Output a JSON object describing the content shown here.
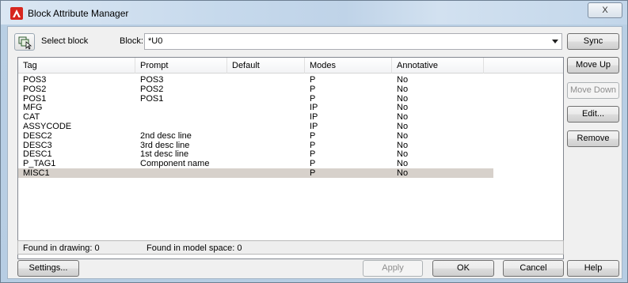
{
  "window": {
    "title": "Block Attribute Manager",
    "close_label": "X"
  },
  "toolbar": {
    "select_block_label": "Select block",
    "block_label": "Block:",
    "block_value": "*U0"
  },
  "side_buttons": {
    "sync": "Sync",
    "move_up": "Move Up",
    "move_down": "Move Down",
    "edit": "Edit...",
    "remove": "Remove"
  },
  "table": {
    "columns": [
      "Tag",
      "Prompt",
      "Default",
      "Modes",
      "Annotative"
    ],
    "rows": [
      {
        "tag": "POS3",
        "prompt": "POS3",
        "default": "",
        "modes": "P",
        "annotative": "No"
      },
      {
        "tag": "POS2",
        "prompt": "POS2",
        "default": "",
        "modes": "P",
        "annotative": "No"
      },
      {
        "tag": "POS1",
        "prompt": "POS1",
        "default": "",
        "modes": "P",
        "annotative": "No"
      },
      {
        "tag": "MFG",
        "prompt": "",
        "default": "",
        "modes": "IP",
        "annotative": "No"
      },
      {
        "tag": "CAT",
        "prompt": "",
        "default": "",
        "modes": "IP",
        "annotative": "No"
      },
      {
        "tag": "ASSYCODE",
        "prompt": "",
        "default": "",
        "modes": "IP",
        "annotative": "No"
      },
      {
        "tag": "DESC2",
        "prompt": "2nd desc line",
        "default": "",
        "modes": "P",
        "annotative": "No"
      },
      {
        "tag": "DESC3",
        "prompt": "3rd desc line",
        "default": "",
        "modes": "P",
        "annotative": "No"
      },
      {
        "tag": "DESC1",
        "prompt": "1st desc line",
        "default": "",
        "modes": "P",
        "annotative": "No"
      },
      {
        "tag": "P_TAG1",
        "prompt": "Component name",
        "default": "",
        "modes": "P",
        "annotative": "No"
      },
      {
        "tag": "MISC1",
        "prompt": "",
        "default": "",
        "modes": "P",
        "annotative": "No"
      }
    ],
    "selected_row": 10
  },
  "status": {
    "found_in_drawing": "Found in drawing: 0",
    "found_in_model_space": "Found in model space: 0"
  },
  "bottom_buttons": {
    "settings": "Settings...",
    "apply": "Apply",
    "ok": "OK",
    "cancel": "Cancel",
    "help": "Help"
  },
  "colors": {
    "selection": "#d7d1cb",
    "icon_red": "#d7261e"
  }
}
